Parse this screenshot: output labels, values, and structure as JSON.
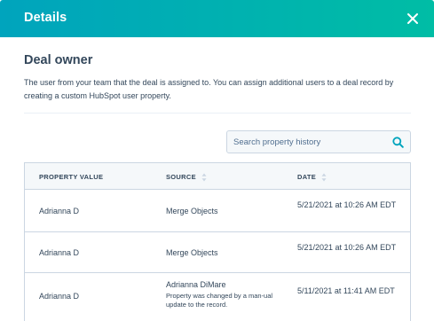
{
  "header": {
    "title": "Details"
  },
  "section": {
    "title": "Deal owner",
    "description": "The user from your team that the deal is assigned to. You can assign additional users to a deal record by creating a custom HubSpot user property."
  },
  "search": {
    "placeholder": "Search property history",
    "value": ""
  },
  "table": {
    "columns": [
      "PROPERTY VALUE",
      "SOURCE",
      "DATE"
    ],
    "rows": [
      {
        "value": "Adrianna D",
        "source": "Merge Objects",
        "source_detail": "",
        "date": "5/21/2021 at 10:26 AM EDT"
      },
      {
        "value": "Adrianna D",
        "source": "Merge Objects",
        "source_detail": "",
        "date": "5/21/2021 at 10:26 AM EDT"
      },
      {
        "value": "Adrianna D",
        "source": "Adrianna DiMare",
        "source_detail": "Property was changed by a man-ual update to the record.",
        "date": "5/11/2021 at 11:41 AM EDT"
      }
    ]
  },
  "icons": {
    "close": "close-icon",
    "search": "search-icon",
    "sort": "sort-icon"
  },
  "colors": {
    "header_start": "#00a4bd",
    "header_end": "#00bda5",
    "text": "#33475b",
    "border": "#cbd6e2",
    "search_icon": "#00a4bd"
  }
}
